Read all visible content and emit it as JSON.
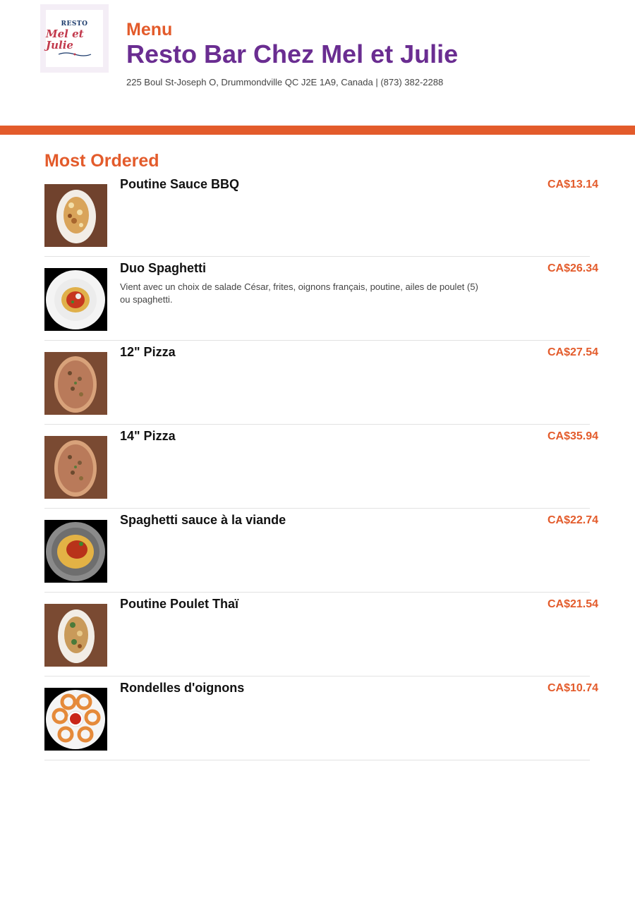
{
  "header": {
    "logo": {
      "top_text": "RESTO",
      "script_text": "Mel et Julie",
      "icon": "restaurant-logo"
    },
    "menu_label": "Menu",
    "restaurant_name": "Resto Bar Chez Mel et Julie",
    "address": "225 Boul St-Joseph O, Drummondville QC J2E 1A9, Canada | (873) 382-2288"
  },
  "section": {
    "title": "Most Ordered"
  },
  "items": [
    {
      "name": "Poutine Sauce BBQ",
      "description": "",
      "price": "CA$13.14",
      "image": "poutine-bbq-photo"
    },
    {
      "name": "Duo Spaghetti",
      "description": "Vient avec un choix de salade César, frites, oignons français, poutine, ailes de poulet (5) ou spaghetti.",
      "price": "CA$26.34",
      "image": "spaghetti-plate-photo"
    },
    {
      "name": "12\" Pizza",
      "description": "",
      "price": "CA$27.54",
      "image": "pizza-photo"
    },
    {
      "name": "14\" Pizza",
      "description": "",
      "price": "CA$35.94",
      "image": "pizza-photo"
    },
    {
      "name": "Spaghetti sauce à la viande",
      "description": "",
      "price": "CA$22.74",
      "image": "spaghetti-bowl-photo"
    },
    {
      "name": "Poutine Poulet Thaï",
      "description": "",
      "price": "CA$21.54",
      "image": "poutine-thai-photo"
    },
    {
      "name": "Rondelles d'oignons",
      "description": "",
      "price": "CA$10.74",
      "image": "onion-rings-photo"
    }
  ],
  "colors": {
    "accent": "#e35b2b",
    "brand": "#6a2d91"
  }
}
